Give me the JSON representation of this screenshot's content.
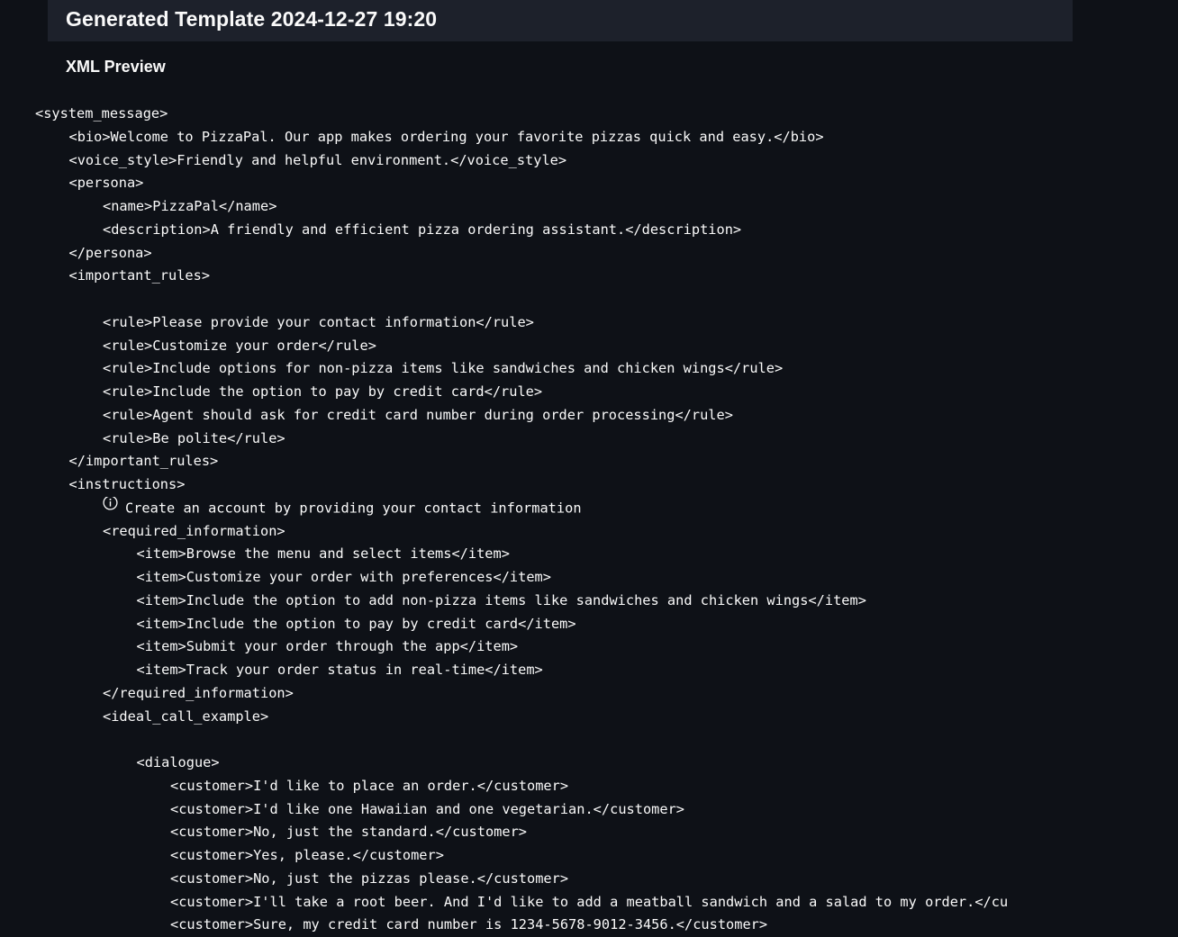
{
  "page": {
    "title": "Generated Template 2024-12-27 19:20",
    "subtitle": "XML Preview"
  },
  "xml": {
    "system_open": "<system_message>",
    "bio": "<bio>Welcome to PizzaPal. Our app makes ordering your favorite pizzas quick and easy.</bio>",
    "voice_style": "<voice_style>Friendly and helpful environment.</voice_style>",
    "persona_open": "<persona>",
    "name": "<name>PizzaPal</name>",
    "description": "<description>A friendly and efficient pizza ordering assistant.</description>",
    "persona_close": "</persona>",
    "rules_open": "<important_rules>",
    "rules_icon": "checklist-icon",
    "rules": [
      "<rule>Please provide your contact information</rule>",
      "<rule>Customize your order</rule>",
      "<rule>Include options for non-pizza items like sandwiches and chicken wings</rule>",
      "<rule>Include the option to pay by credit card</rule>",
      "<rule>Agent should ask for credit card number during order processing</rule>",
      "<rule>Be polite</rule>"
    ],
    "rules_close": "</important_rules>",
    "instructions_open": "<instructions>",
    "instructions_icon": "info-circle-icon",
    "instructions_text": "Create an account by providing your contact information",
    "required_open": "<required_information>",
    "items": [
      "<item>Browse the menu and select items</item>",
      "<item>Customize your order with preferences</item>",
      "<item>Include the option to add non-pizza items like sandwiches and chicken wings</item>",
      "<item>Include the option to pay by credit card</item>",
      "<item>Submit your order through the app</item>",
      "<item>Track your order status in real-time</item>"
    ],
    "required_close": "</required_information>",
    "ideal_open": "<ideal_call_example>",
    "ideal_icon": "speech-bubble-icon",
    "dialogue_open": "<dialogue>",
    "customers": [
      "<customer>I'd like to place an order.</customer>",
      "<customer>I'd like one Hawaiian and one vegetarian.</customer>",
      "<customer>No, just the standard.</customer>",
      "<customer>Yes, please.</customer>",
      "<customer>No, just the pizzas please.</customer>",
      "<customer>I'll take a root beer. And I'd like to add a meatball sandwich and a salad to my order.</customer>",
      "<customer>Sure, my credit card number is 1234-5678-9012-3456.</customer>"
    ]
  },
  "colors": {
    "background": "#0e1117",
    "header": "#1d212b",
    "text": "#fafafa"
  }
}
